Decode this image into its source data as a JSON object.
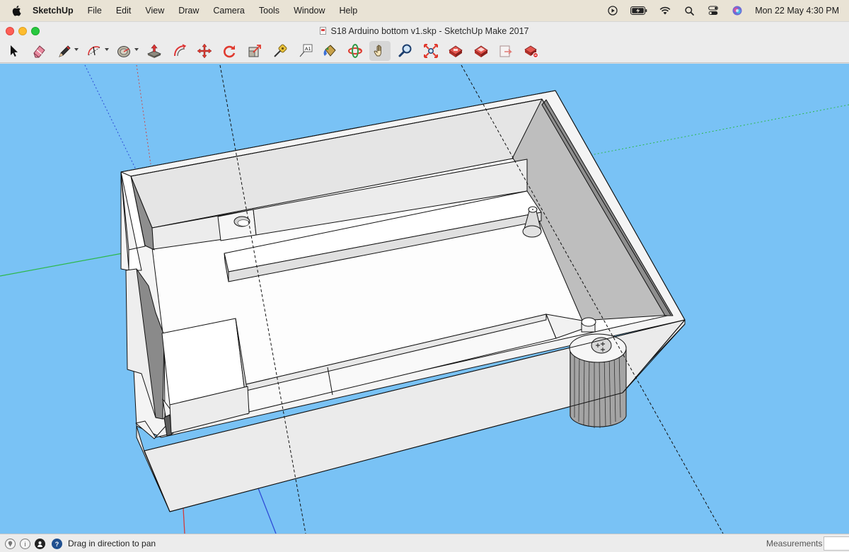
{
  "menubar": {
    "app_name": "SketchUp",
    "items": [
      "File",
      "Edit",
      "View",
      "Draw",
      "Camera",
      "Tools",
      "Window",
      "Help"
    ],
    "clock": "Mon 22 May  4:30 PM"
  },
  "window": {
    "title": "S18 Arduino bottom v1.skp - SketchUp Make 2017"
  },
  "toolbar": {
    "tools": [
      "select",
      "eraser",
      "pencil-line",
      "arc",
      "shapes",
      "push-pull",
      "follow-me",
      "move",
      "rotate",
      "scale",
      "tape-measure",
      "text",
      "paint-bucket",
      "orbit",
      "pan",
      "zoom",
      "zoom-extents",
      "warehouse",
      "extension-warehouse",
      "send-to-layout",
      "extension-manager"
    ],
    "active_tool": "pan"
  },
  "colors": {
    "sky": "#79c2f5",
    "model_face": "#ffffff",
    "model_shade": "#8e8e8e",
    "axis_red": "#d23b3b",
    "axis_green": "#2db84a",
    "axis_blue": "#2f4bd6"
  },
  "statusbar": {
    "hint": "Drag in direction to pan",
    "measurements_label": "Measurements",
    "measurements_value": ""
  }
}
